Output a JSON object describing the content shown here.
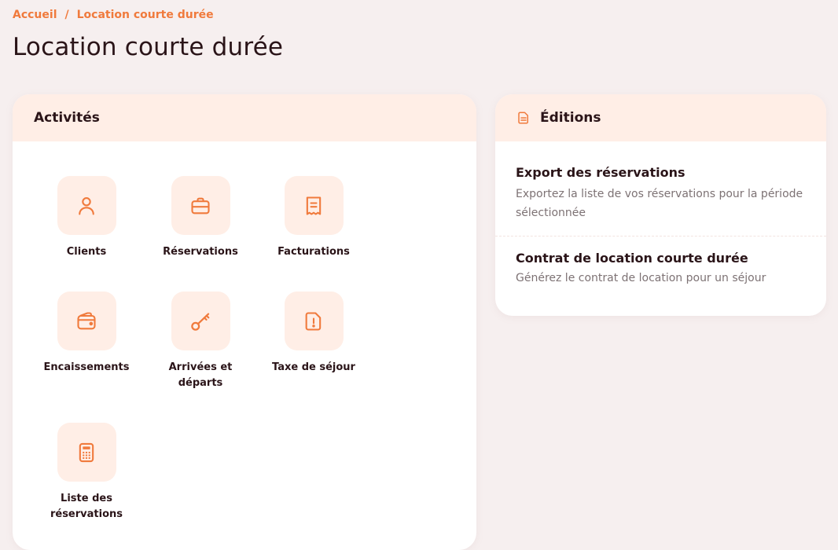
{
  "breadcrumb": {
    "home": "Accueil",
    "separator": "/",
    "current": "Location courte durée"
  },
  "page": {
    "title": "Location courte durée"
  },
  "activities": {
    "title": "Activités",
    "items": [
      {
        "label": "Clients",
        "icon": "user-icon"
      },
      {
        "label": "Réservations",
        "icon": "briefcase-icon"
      },
      {
        "label": "Facturations",
        "icon": "receipt-icon"
      },
      {
        "label": "Encaissements",
        "icon": "wallet-icon"
      },
      {
        "label": "Arrivées et départs",
        "icon": "key-icon"
      },
      {
        "label": "Taxe de séjour",
        "icon": "document-alert-icon"
      },
      {
        "label": "Liste des réservations",
        "icon": "calculator-icon"
      }
    ]
  },
  "editions": {
    "title": "Éditions",
    "icon": "document-icon",
    "items": [
      {
        "title": "Export des réservations",
        "description": "Exportez la liste de vos réservations pour la période sélectionnée"
      },
      {
        "title": "Contrat de location courte durée",
        "description": "Générez le contrat de location pour un séjour"
      }
    ]
  },
  "colors": {
    "accent": "#f07a3c",
    "tile_bg": "#ffeee6",
    "page_bg": "#f6efef"
  }
}
